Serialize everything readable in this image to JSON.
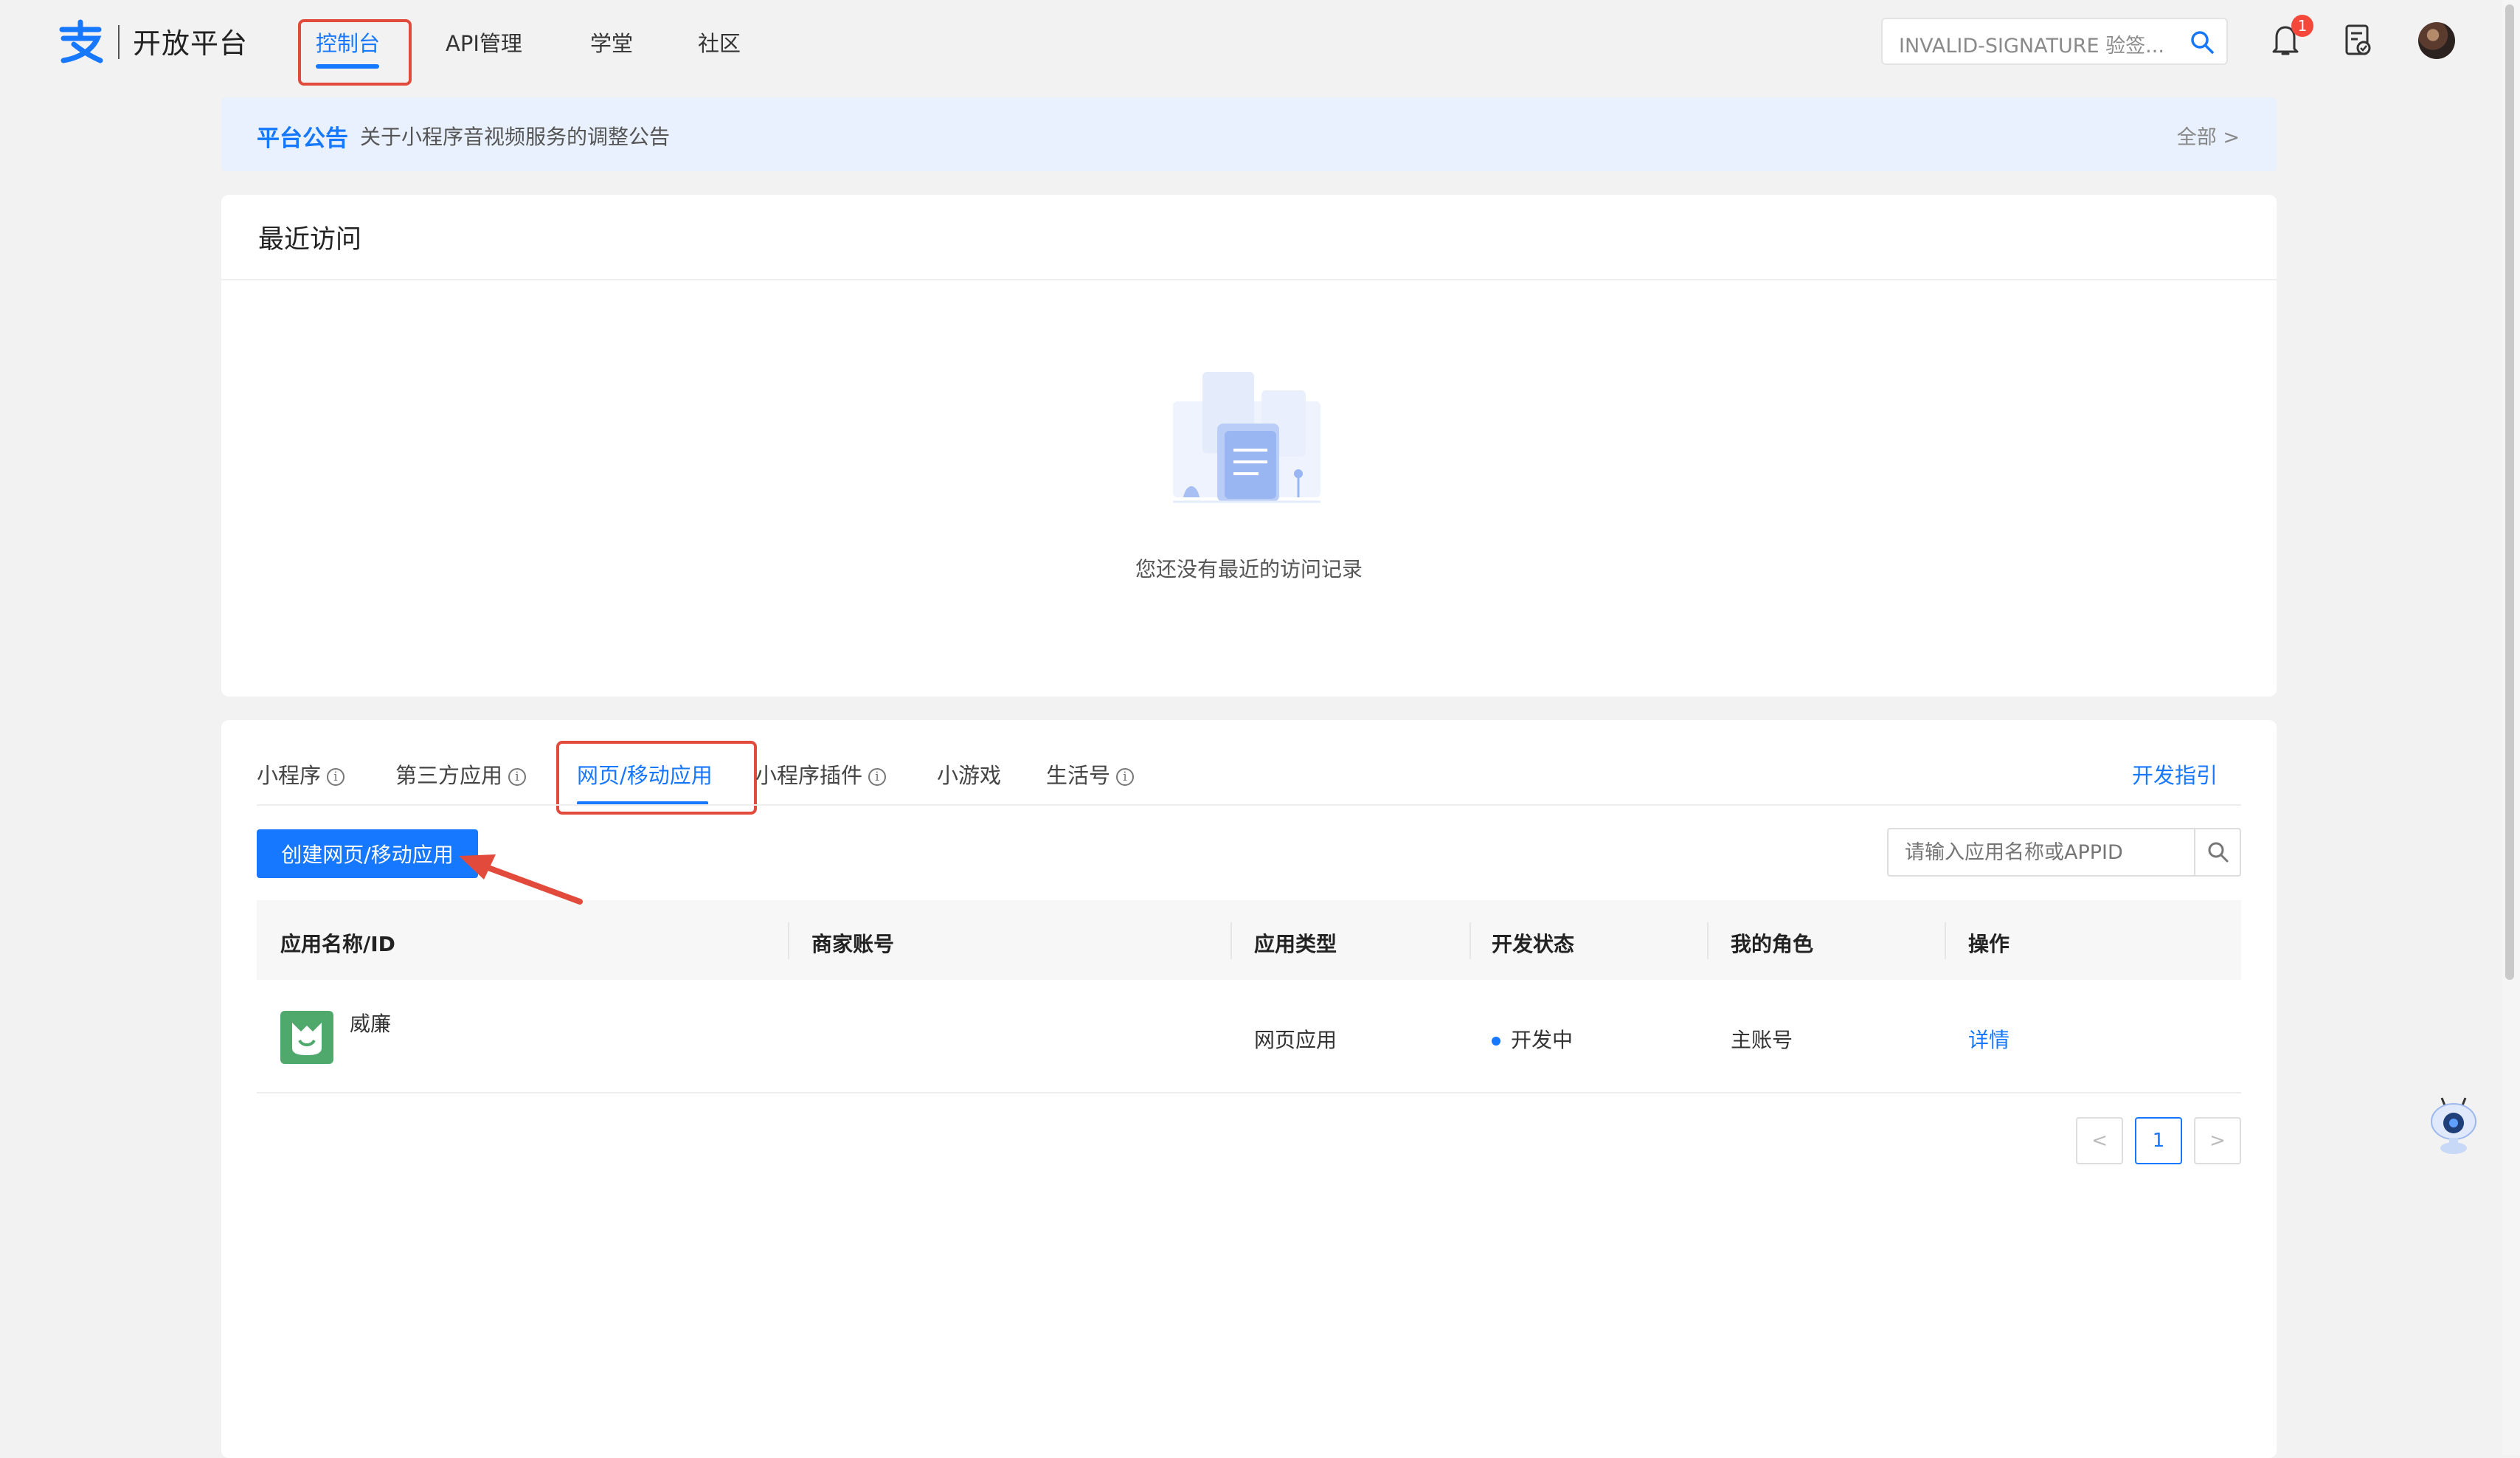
{
  "header": {
    "logo_text": "开放平台",
    "nav": [
      {
        "label": "控制台",
        "active": true
      },
      {
        "label": "API管理",
        "active": false
      },
      {
        "label": "学堂",
        "active": false
      },
      {
        "label": "社区",
        "active": false
      }
    ],
    "search_text": "INVALID-SIGNATURE 验签...",
    "notification_count": "1"
  },
  "announcement": {
    "title": "平台公告",
    "text": "关于小程序音视频服务的调整公告",
    "all_link": "全部 >"
  },
  "recent": {
    "title": "最近访问",
    "empty_text": "您还没有最近的访问记录"
  },
  "apps": {
    "tabs": [
      {
        "label": "小程序",
        "info": true
      },
      {
        "label": "第三方应用",
        "info": true
      },
      {
        "label": "网页/移动应用",
        "info": false,
        "active": true
      },
      {
        "label": "小程序插件",
        "info": true
      },
      {
        "label": "小游戏",
        "info": false
      },
      {
        "label": "生活号",
        "info": true
      }
    ],
    "dev_guide": "开发指引",
    "create_button": "创建网页/移动应用",
    "search_placeholder": "请输入应用名称或APPID",
    "columns": [
      "应用名称/ID",
      "商家账号",
      "应用类型",
      "开发状态",
      "我的角色",
      "操作"
    ],
    "rows": [
      {
        "name": "威廉",
        "merchant": "",
        "type": "网页应用",
        "status": "开发中",
        "role": "主账号",
        "action": "详情"
      }
    ],
    "pagination": {
      "prev": "<",
      "current": "1",
      "next": ">"
    }
  },
  "colors": {
    "accent": "#1677ff",
    "highlight": "#e24a3b",
    "announce_bg": "#e8f1fd"
  }
}
